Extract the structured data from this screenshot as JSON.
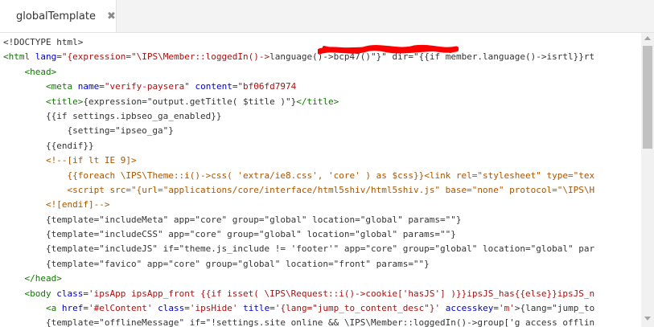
{
  "tab": {
    "title": "globalTemplate",
    "close_icon": "close-icon"
  },
  "colors": {
    "tag": "#117700",
    "attribute": "#0000cc",
    "string": "#aa1111",
    "comment": "#aa5500",
    "redaction": "#ff0000"
  },
  "code": [
    [
      [
        "txt",
        "<!DOCTYPE html>"
      ]
    ],
    [
      [
        "tag",
        "<html"
      ],
      [
        "txt",
        " "
      ],
      [
        "attr",
        "lang"
      ],
      [
        "txt",
        "="
      ],
      [
        "str",
        "\"{expression=\"\\IPS\\Member::loggedIn()->"
      ],
      [
        "txt",
        "language()->bcp47()\"}\" dir=\"{{if member.language()->isrtl}}rt"
      ]
    ],
    [
      [
        "txt",
        "    "
      ],
      [
        "tag",
        "<head>"
      ]
    ],
    [
      [
        "txt",
        "        "
      ],
      [
        "tag",
        "<meta"
      ],
      [
        "txt",
        " "
      ],
      [
        "attr",
        "name"
      ],
      [
        "txt",
        "="
      ],
      [
        "str",
        "\"verify-paysera\""
      ],
      [
        "txt",
        " "
      ],
      [
        "attr",
        "content"
      ],
      [
        "txt",
        "="
      ],
      [
        "str",
        "\"bf06fd7974"
      ]
    ],
    [
      [
        "txt",
        "        "
      ],
      [
        "tag",
        "<title>"
      ],
      [
        "txt",
        "{expression=\"output.getTitle( $title )\"}"
      ],
      [
        "tag",
        "</title>"
      ]
    ],
    [
      [
        "txt",
        "        {{if settings.ipbseo_ga_enabled}}"
      ]
    ],
    [
      [
        "txt",
        "            {setting=\"ipseo_ga\"}"
      ]
    ],
    [
      [
        "txt",
        "        {{endif}}"
      ]
    ],
    [
      [
        "txt",
        "        "
      ],
      [
        "cmt",
        "<!--[if lt IE 9]>"
      ]
    ],
    [
      [
        "txt",
        "            "
      ],
      [
        "cmt",
        "{{foreach \\IPS\\Theme::i()->css( 'extra/ie8.css', 'core' ) as $css}}<link rel=\"stylesheet\" type=\"tex"
      ]
    ],
    [
      [
        "txt",
        "            "
      ],
      [
        "cmt",
        "<script src=\"{url=\"applications/core/interface/html5shiv/html5shiv.js\" base=\"none\" protocol=\"\\IPS\\H"
      ]
    ],
    [
      [
        "txt",
        "        "
      ],
      [
        "cmt",
        "<![endif]-->"
      ]
    ],
    [
      [
        "txt",
        "        {template=\"includeMeta\" app=\"core\" group=\"global\" location=\"global\" params=\"\"}"
      ]
    ],
    [
      [
        "txt",
        "        {template=\"includeCSS\" app=\"core\" group=\"global\" location=\"global\" params=\"\"}"
      ]
    ],
    [
      [
        "txt",
        "        {template=\"includeJS\" if=\"theme.js_include != 'footer'\" app=\"core\" group=\"global\" location=\"global\" par"
      ]
    ],
    [
      [
        "txt",
        "        {template=\"favico\" app=\"core\" group=\"global\" location=\"front\" params=\"\"}"
      ]
    ],
    [
      [
        "txt",
        "    "
      ],
      [
        "tag",
        "</head>"
      ]
    ],
    [
      [
        "txt",
        "    "
      ],
      [
        "tag",
        "<body"
      ],
      [
        "txt",
        " "
      ],
      [
        "attr",
        "class"
      ],
      [
        "txt",
        "="
      ],
      [
        "str",
        "'ipsApp ipsApp_front {{if isset( \\IPS\\Request::i()->cookie['hasJS'] )}}ipsJS_has{{else}}ipsJS_n"
      ]
    ],
    [
      [
        "txt",
        "        "
      ],
      [
        "tag",
        "<a"
      ],
      [
        "txt",
        " "
      ],
      [
        "attr",
        "href"
      ],
      [
        "txt",
        "="
      ],
      [
        "str",
        "'#elContent'"
      ],
      [
        "txt",
        " "
      ],
      [
        "attr",
        "class"
      ],
      [
        "txt",
        "="
      ],
      [
        "str",
        "'ipsHide'"
      ],
      [
        "txt",
        " "
      ],
      [
        "attr",
        "title"
      ],
      [
        "txt",
        "="
      ],
      [
        "str",
        "'{lang=\"jump_to_content_desc\"}'"
      ],
      [
        "txt",
        " "
      ],
      [
        "attr",
        "accesskey"
      ],
      [
        "txt",
        "="
      ],
      [
        "str",
        "'m'"
      ],
      [
        "txt",
        ">{lang=\"jump_to"
      ]
    ],
    [
      [
        "txt",
        "        {template=\"offlineMessage\" if=\"!settings.site_online && \\IPS\\Member::loggedIn()->group['g_access_offlin"
      ]
    ]
  ]
}
